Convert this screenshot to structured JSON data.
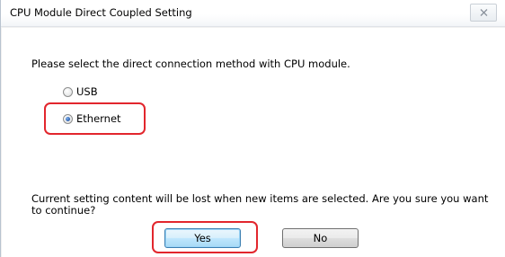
{
  "window": {
    "title": "CPU Module Direct Coupled Setting"
  },
  "dialog": {
    "prompt": "Please select the direct connection method with CPU module.",
    "options": [
      {
        "label": "USB",
        "selected": false
      },
      {
        "label": "Ethernet",
        "selected": true
      }
    ],
    "warning": "Current setting content will be lost when new items are selected. Are you sure you want to continue?",
    "buttons": {
      "yes": "Yes",
      "no": "No"
    }
  },
  "colors": {
    "highlight": "#e2262d",
    "radio_selected": "#2b5fae",
    "default_button_border": "#3c7fb1"
  },
  "icons": {
    "close": "close-icon"
  }
}
